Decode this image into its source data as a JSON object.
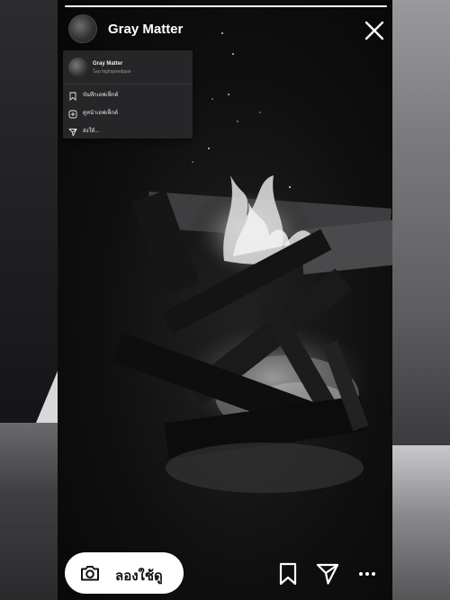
{
  "story": {
    "progress": 1.0,
    "username": "Gray Matter"
  },
  "effect_card": {
    "effect_name": "Gray Matter",
    "creator": "โดย highspeedjase",
    "menu": [
      {
        "label": "บันทึกเอฟเฟ็กต์",
        "icon": "bookmark-icon"
      },
      {
        "label": "ดูหน้าเอฟเฟ็กต์",
        "icon": "effect-page-icon"
      },
      {
        "label": "ส่งให้...",
        "icon": "send-icon"
      }
    ]
  },
  "bottom_bar": {
    "try_label": "ลองใช้ดู",
    "icons": [
      "camera-icon",
      "bookmark-icon",
      "send-icon",
      "more-icon"
    ]
  },
  "colors": {
    "story_bg": "#0f0f10",
    "card_bg": "#28282a",
    "button_bg": "#ffffff",
    "text": "#ffffff"
  }
}
